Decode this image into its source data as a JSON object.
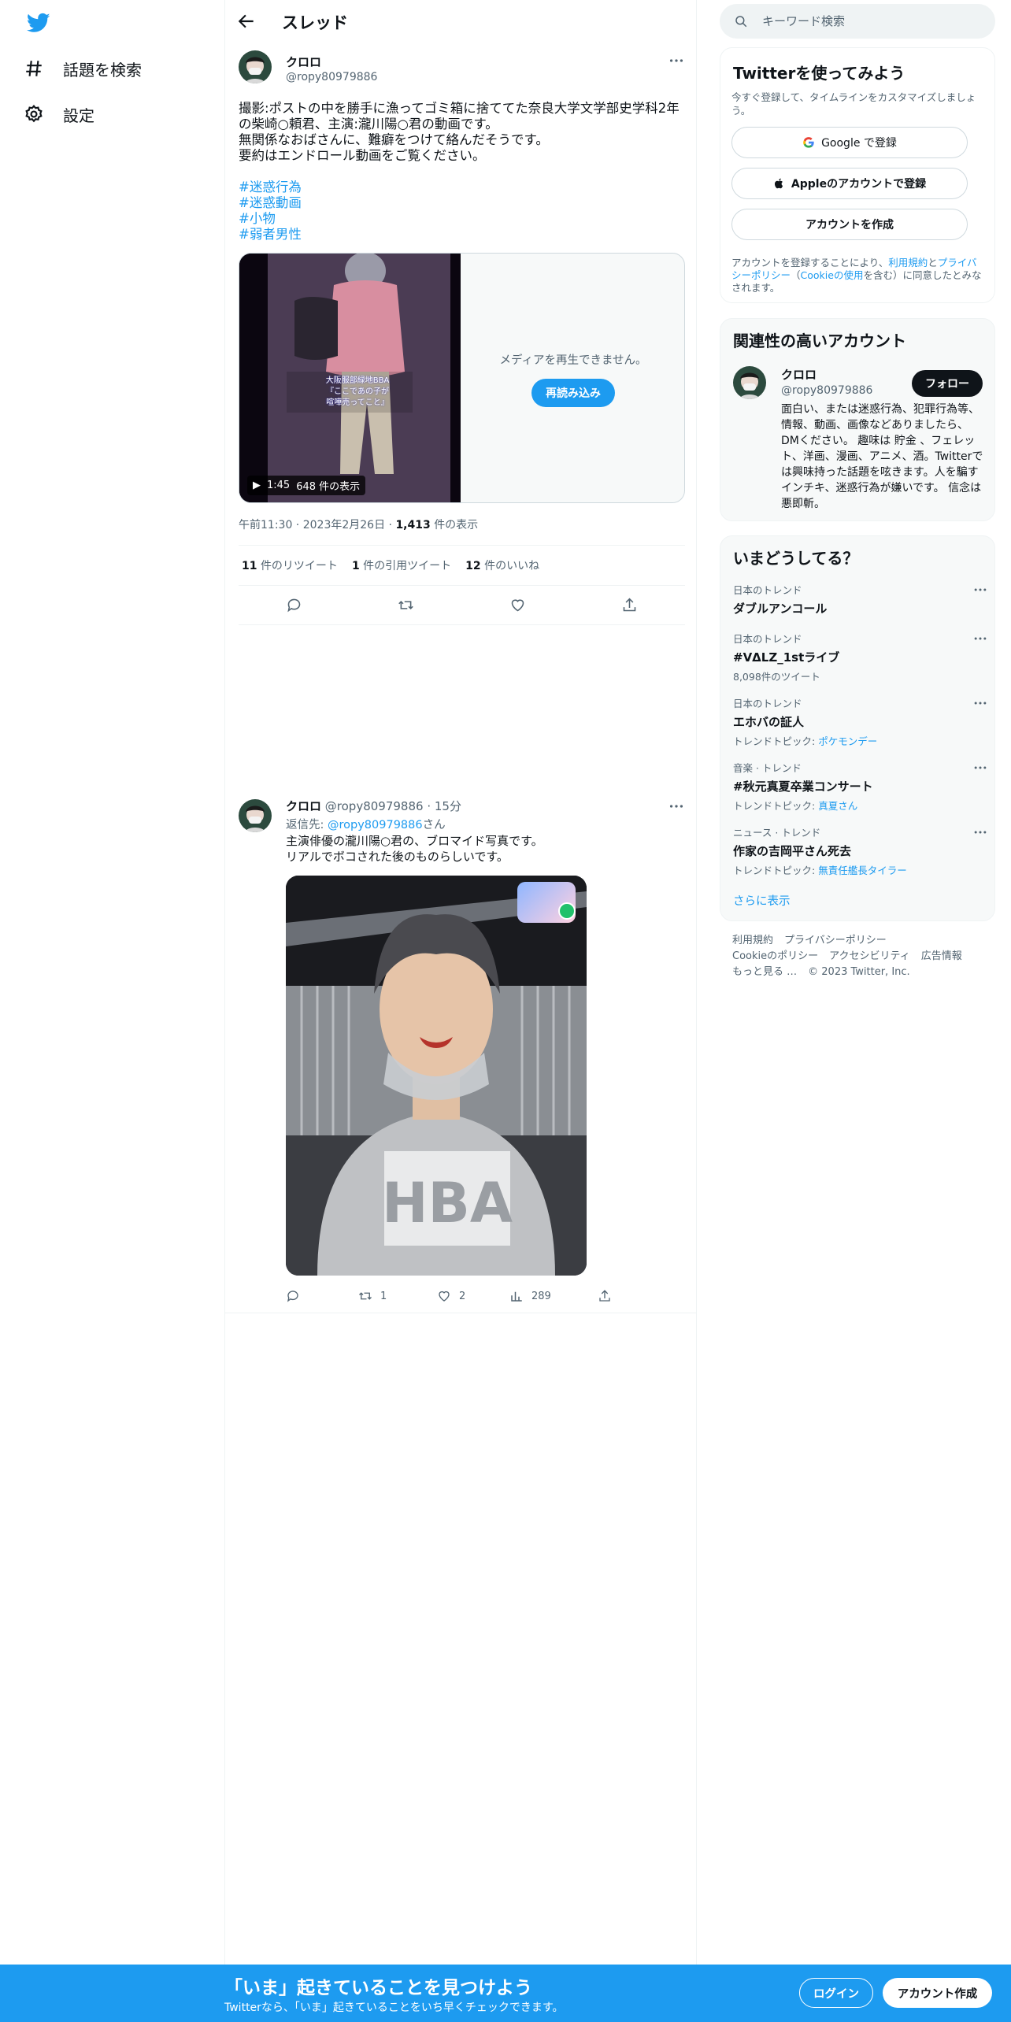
{
  "sidebar": {
    "logo": "twitter-bird-icon",
    "items": [
      {
        "label": "話題を検索",
        "icon": "hashtag-icon"
      },
      {
        "label": "設定",
        "icon": "gear-icon"
      }
    ]
  },
  "header": {
    "title": "スレッド",
    "back_icon": "back-arrow-icon"
  },
  "tweet1": {
    "name": "クロロ",
    "handle": "@ropy80979886",
    "body": "撮影:ポストの中を勝手に漁ってゴミ箱に捨ててた奈良大学文学部史学科2年の柴崎○頼君、主演:瀧川陽○君の動画です。\n無関係なおばさんに、難癖をつけて絡んだそうです。\n要約はエンドロール動画をご覧ください。",
    "hashtags": [
      "#迷惑行為",
      "#迷惑動画",
      "#小物",
      "#弱者男性"
    ],
    "media": {
      "caption_line1": "大阪服部緑地BBA",
      "caption_line2": "『ここであの子が",
      "caption_line3": "喧嘩売ってこと』",
      "duration": "1:45",
      "views": "648 件の表示",
      "error_text": "メディアを再生できません。",
      "reload_label": "再読み込み"
    },
    "time": "午前11:30",
    "date": "2023年2月26日",
    "view_count": "1,413",
    "view_label": "件の表示",
    "stats": [
      {
        "count": "11",
        "label": "件のリツイート"
      },
      {
        "count": "1",
        "label": "件の引用ツイート"
      },
      {
        "count": "12",
        "label": "件のいいね"
      }
    ]
  },
  "tweet2": {
    "name": "クロロ",
    "handle": "@ropy80979886",
    "time": "15分",
    "reply_prefix": "返信先:",
    "reply_to": "@ropy80979886",
    "reply_suffix": "さん",
    "body": "主演俳優の瀧川陽○君の、ブロマイド写真です。\nリアルでボコされた後のものらしいです。",
    "photo_text": "HBA",
    "retweets": "1",
    "likes": "2",
    "views": "289"
  },
  "search": {
    "placeholder": "キーワード検索"
  },
  "signup": {
    "title": "Twitterを使ってみよう",
    "subtitle": "今すぐ登録して、タイムラインをカスタマイズしましょう。",
    "google_label": "Google で登録",
    "apple_label": "Appleのアカウントで登録",
    "create_label": "アカウントを作成",
    "legal_prefix": "アカウントを登録することにより、",
    "terms": "利用規約",
    "and": "と",
    "privacy": "プライバシーポリシー",
    "cookie_open": "（",
    "cookie": "Cookieの使用",
    "legal_suffix": "を含む）に同意したとみなされます。"
  },
  "related": {
    "title": "関連性の高いアカウント",
    "name": "クロロ",
    "handle": "@ropy80979886",
    "follow_label": "フォロー",
    "bio": "面白い、または迷惑行為、犯罪行為等、情報、動画、画像などありましたら、DMください。 趣味は 貯金 、フェレット、洋画、漫画、アニメ、酒。Twitterでは興味持った話題を呟きます。人を騙すインチキ、迷惑行為が嫌いです。 信念は悪即斬。"
  },
  "trends": {
    "title": "いまどうしてる？",
    "items": [
      {
        "category": "日本のトレンド",
        "name": "ダブルアンコール",
        "sub_prefix": "",
        "sub_link": ""
      },
      {
        "category": "日本のトレンド",
        "name": "#VΔLZ_1stライブ",
        "sub_prefix": "8,098件のツイート",
        "sub_link": ""
      },
      {
        "category": "日本のトレンド",
        "name": "エホバの証人",
        "sub_prefix": "トレンドトピック: ",
        "sub_link": "ポケモンデー"
      },
      {
        "category": "音楽 · トレンド",
        "name": "#秋元真夏卒業コンサート",
        "sub_prefix": "トレンドトピック: ",
        "sub_link": "真夏さん"
      },
      {
        "category": "ニュース · トレンド",
        "name": "作家の吉岡平さん死去",
        "sub_prefix": "トレンドトピック: ",
        "sub_link": "無責任艦長タイラー"
      }
    ],
    "show_more": "さらに表示"
  },
  "footer": {
    "links": [
      "利用規約",
      "プライバシーポリシー",
      "Cookieのポリシー",
      "アクセシビリティ",
      "広告情報",
      "もっと見る …"
    ],
    "copyright": "© 2023 Twitter, Inc."
  },
  "bottom_bar": {
    "title": "「いま」起きていることを見つけよう",
    "subtitle": "Twitterなら、「いま」起きていることをいち早くチェックできます。",
    "login": "ログイン",
    "signup": "アカウント作成"
  },
  "colors": {
    "accent": "#1d9bf0",
    "text": "#0f1419",
    "muted": "#536471",
    "border": "#eff3f4"
  }
}
